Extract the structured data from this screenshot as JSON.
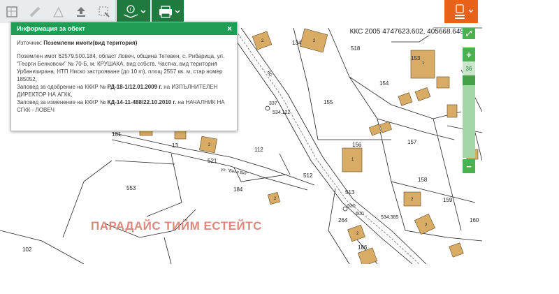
{
  "toolbar": {
    "tools": [
      {
        "name": "measure-area-icon"
      },
      {
        "name": "ruler-icon"
      },
      {
        "name": "measure-angle-icon"
      },
      {
        "name": "upload-icon"
      },
      {
        "name": "select-region-icon"
      },
      {
        "name": "info-layers-icon"
      },
      {
        "name": "print-icon"
      },
      {
        "name": "menu-icon"
      }
    ],
    "accent_green": "#1f7a3f",
    "accent_orange": "#e8621a"
  },
  "coordinates": "ККС 2005 4747623.602, 405668.649",
  "zoom": {
    "plus": "+",
    "minus": "−",
    "level": "36"
  },
  "popup": {
    "title": "Информация за обект",
    "close": "×",
    "source_label": "Източник: ",
    "source_value": "Поземлени имоти(вид територия)",
    "description": "Поземлен имот 62579.500.184, област Ловеч, община Тетевен, с. Рибарица, ул. \"Георги Бенковски\" № 70-Б, м. КРУШАКА, вид собств. Частна, вид територия Урбанизирана, НТП Ниско застрояване (до 10 m), площ 2557 кв. м, стар номер 185052,",
    "approval_label": "Заповед за одобрение на КККР № ",
    "approval_value": "РД-18-1/12.01.2009 г.",
    "approval_suffix": " на ИЗПЪЛНИТЕЛЕН ДИРЕКТОР НА АГКК,",
    "change_label": "Заповед за изменение на КККР № ",
    "change_value": "КД-14-11-488/22.10.2010 г.",
    "change_suffix": " на НАЧАЛНИК НА СГКК - ЛОВЕЧ"
  },
  "watermark": "ПАРАДАЙС ТИЙМ ЕСТЕЙТС",
  "map": {
    "parcel_labels": [
      "134",
      "518",
      "153",
      "154",
      "155",
      "156",
      "157",
      "158",
      "159",
      "160",
      "181",
      "13",
      "112",
      "184",
      "553",
      "512",
      "513",
      "264",
      "186",
      "102",
      "521",
      "1",
      "2"
    ],
    "street_label": "ул. \"Бели Вит\"",
    "point_labels": [
      "337",
      "534.122",
      "530",
      "534.385",
      "600",
      "60"
    ]
  }
}
